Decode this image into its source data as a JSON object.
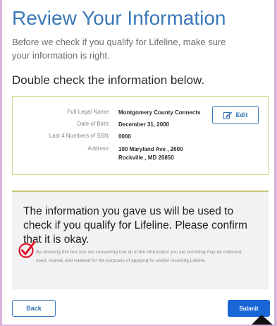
{
  "page": {
    "title": "Review Your Information",
    "intro": "Before we check if you qualify for Lifeline, make sure your information is right.",
    "section_heading": "Double check the information below."
  },
  "info": {
    "rows": [
      {
        "label": "Full Legal Name:",
        "value": "Montgomery County Connects"
      },
      {
        "label": "Date of Birth:",
        "value": "December 31, 2000"
      },
      {
        "label": "Last 4 Numbers of SSN:",
        "value": "0000"
      },
      {
        "label": "Address:",
        "value": "100 Maryland Ave , 2600\nRockville , MD 20850"
      }
    ],
    "edit_label": "Edit"
  },
  "notice": {
    "text": "The information you gave us will be used to check if you qualify for Lifeline. Please confirm that it is okay.",
    "consent_label": "By checking this box you are consenting that all of the information you are providing may be collected, used, shared, and retained for the purposes of applying for and/or receiving Lifeline.",
    "checked": true
  },
  "footer": {
    "back_label": "Back",
    "submit_label": "Submit"
  },
  "colors": {
    "title": "#3a78b8",
    "primary": "#1a66d6",
    "check_mark": "#e0102a",
    "border_accent": "#d8d48a",
    "background": "#d9b3d9"
  },
  "icons": [
    "edit-icon",
    "check-icon",
    "cursor-icon"
  ]
}
